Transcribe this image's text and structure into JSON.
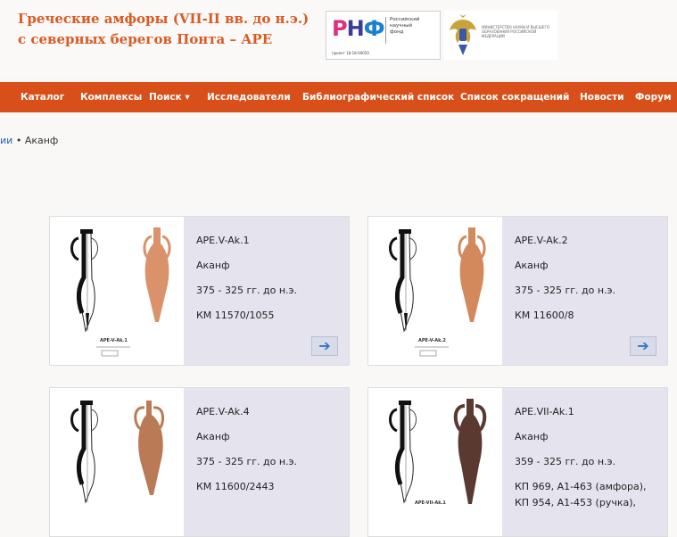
{
  "header": {
    "title_line1": "Греческие амфоры (VII-II вв. до н.э.)",
    "title_line2": "с северных берегов Понта – АРЕ",
    "sponsor": {
      "logo_parts": [
        "Р",
        "Н",
        "Ф"
      ],
      "logo_colors": [
        "#e22d7e",
        "#3b3b9b",
        "#1a7fcf"
      ],
      "name_line1": "Российский",
      "name_line2": "научный",
      "name_line3": "фонд",
      "grant": "проект 18-18-00050"
    },
    "ministry": {
      "text": "МИНИСТЕРСТВО НАУКИ И ВЫСШЕГО ОБРАЗОВАНИЯ РОССИЙСКОЙ ФЕДЕРАЦИИ"
    }
  },
  "nav": {
    "items": [
      "Каталог",
      "Комплексы",
      "Поиск ▾",
      "Исследователи",
      "Библиографический список",
      "Список сокращений",
      "Новости",
      "Форум"
    ]
  },
  "breadcrumb": {
    "link": "ии",
    "separator": "•",
    "current": "Аканф"
  },
  "cards": [
    {
      "code": "APE.V-Ak.1",
      "center": "Аканф",
      "date": "375 - 325 гг. до н.э.",
      "inv": "КМ 11570/1055",
      "inv2": "",
      "drawing_label": "APE-V-Ak.1",
      "clay_color": "#d9926a",
      "has_button": true
    },
    {
      "code": "APE.V-Ak.2",
      "center": "Аканф",
      "date": "375 - 325 гг. до н.э.",
      "inv": "КМ 11600/8",
      "inv2": "",
      "drawing_label": "APE-V-Ak.2",
      "clay_color": "#d4895c",
      "has_button": true
    },
    {
      "code": "APE.V-Ak.4",
      "center": "Аканф",
      "date": "375 - 325 гг. до н.э.",
      "inv": "КМ 11600/2443",
      "inv2": "",
      "drawing_label": "APE-V-Ak.4",
      "clay_color": "#b97a55",
      "has_button": false
    },
    {
      "code": "APE.VII-Ak.1",
      "center": "Аканф",
      "date": "359 - 325 гг. до н.э.",
      "inv": "КП 969, А1-463 (амфора),",
      "inv2": "КП 954, А1-453 (ручка),",
      "drawing_label": "APE-VII-Ak.1",
      "clay_color": "#5a3a30",
      "has_button": false
    }
  ],
  "button_icon": "arrow-right-icon",
  "colors": {
    "accent": "#d84f1a",
    "title": "#d95b24",
    "link": "#2a64b5",
    "card_bg": "#e5e4ee"
  }
}
